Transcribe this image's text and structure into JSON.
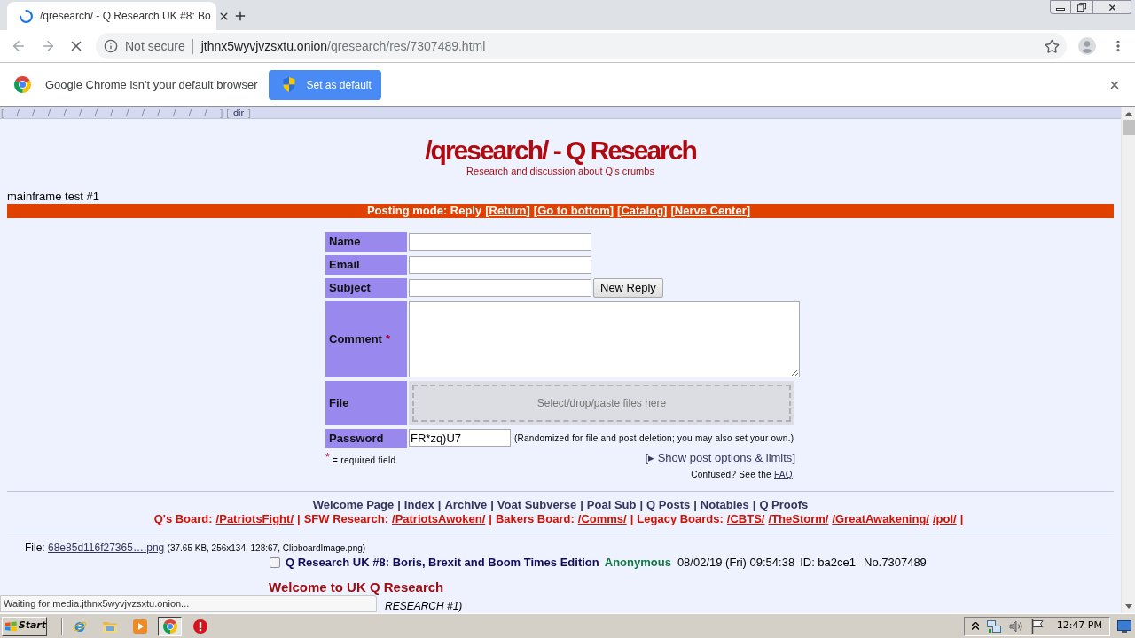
{
  "browser": {
    "tab": {
      "title": "/qresearch/ - Q Research UK #8: Bo",
      "loading": true
    },
    "address": {
      "security": "Not secure",
      "host": "jthnx5wyvjvzsxtu.onion",
      "path": "/qresearch/res/7307489.html"
    },
    "infobar": {
      "message": "Google Chrome isn't your default browser",
      "button": "Set as default"
    }
  },
  "page": {
    "board_list": [
      {
        "open": "[",
        "items": [
          "/",
          "/",
          "/",
          "/",
          "/",
          "/",
          "/",
          "/",
          "/",
          "/",
          "/",
          "/",
          "/"
        ],
        "close": "]"
      },
      {
        "open": "[",
        "items": [
          "dir"
        ],
        "close": "]"
      }
    ],
    "title": "/qresearch/ - Q Research",
    "subtitle": "Research and discussion about Q's crumbs",
    "announcement": "mainframe test #1",
    "posting_bar": {
      "label": "Posting mode: Reply",
      "links": [
        {
          "open": "[",
          "text": "Return",
          "close": "]"
        },
        {
          "open": "[",
          "text": "Go to bottom",
          "close": "]"
        },
        {
          "open": "[",
          "text": "Catalog",
          "close": "]"
        },
        {
          "open": "[",
          "text": "Nerve Center",
          "close": "]"
        }
      ]
    },
    "form": {
      "rows": [
        {
          "kind": "text",
          "label": "Name"
        },
        {
          "kind": "text",
          "label": "Email"
        },
        {
          "kind": "text_button",
          "label": "Subject",
          "button": "New Reply"
        },
        {
          "kind": "textarea",
          "label": "Comment",
          "required_mark": "*"
        },
        {
          "kind": "dropzone",
          "label": "File",
          "placeholder": "Select/drop/paste files here"
        },
        {
          "kind": "password",
          "label": "Password",
          "value": "FR*zq)U7",
          "note": "(Randomized for file and post deletion; you may also set your own.)"
        }
      ],
      "required_note": {
        "mark": "*",
        "text": "= required field"
      },
      "options_link": {
        "open": "[",
        "text": "▸ Show post options & limits",
        "close": "]"
      },
      "help": {
        "text": "Confused? See the",
        "link": "FAQ",
        "after": "."
      }
    },
    "nav_links": [
      {
        "text": "Welcome Page",
        "after": "|"
      },
      {
        "text": "Index",
        "after": "|"
      },
      {
        "text": "Archive",
        "after": "|"
      },
      {
        "text": "Voat Subverse",
        "after": "|"
      },
      {
        "text": "Poal Sub",
        "after": "|"
      },
      {
        "text": "Q Posts",
        "after": "|"
      },
      {
        "text": "Notables",
        "after": "|"
      },
      {
        "text": "Q Proofs"
      }
    ],
    "board_links": [
      {
        "label": "Q's Board:",
        "links": [
          "/PatriotsFight/"
        ],
        "after": "|"
      },
      {
        "label": "SFW Research:",
        "links": [
          "/PatriotsAwoken/"
        ],
        "after": "|"
      },
      {
        "label": "Bakers Board:",
        "links": [
          "/Comms/"
        ],
        "after": "|"
      },
      {
        "label": "Legacy Boards:",
        "links": [
          "/CBTS/",
          "/TheStorm/",
          "/GreatAwakening/",
          "/pol/"
        ],
        "after": "|"
      }
    ],
    "post": {
      "file": {
        "label": "File:",
        "link": "68e85d116f27365….png",
        "info": "(37.65 KB, 256x134, 128:67, ClipboardImage.png)"
      },
      "checked": false,
      "subject": "Q Research UK #8: Boris, Brexit and Boom Times Edition",
      "name": "Anonymous",
      "date": "08/02/19 (Fri) 09:54:38",
      "id": "ID: ba2ce1",
      "number": "No.7307489",
      "body": [
        {
          "kind": "heading",
          "text": "Welcome to UK Q Research"
        },
        {
          "kind": "italic",
          "text": "RESEARCH #1)"
        }
      ]
    }
  },
  "status_bubble": "Waiting for media.jthnx5wyvjvzsxtu.onion...",
  "taskbar": {
    "start": "Start",
    "apps": [
      {
        "kind": "browser",
        "selected": false
      },
      {
        "kind": "folder",
        "selected": false
      },
      {
        "kind": "media",
        "selected": false
      },
      {
        "kind": "chrome",
        "selected": true
      },
      {
        "kind": "alert",
        "selected": false
      }
    ],
    "clock": "12:47 PM"
  }
}
